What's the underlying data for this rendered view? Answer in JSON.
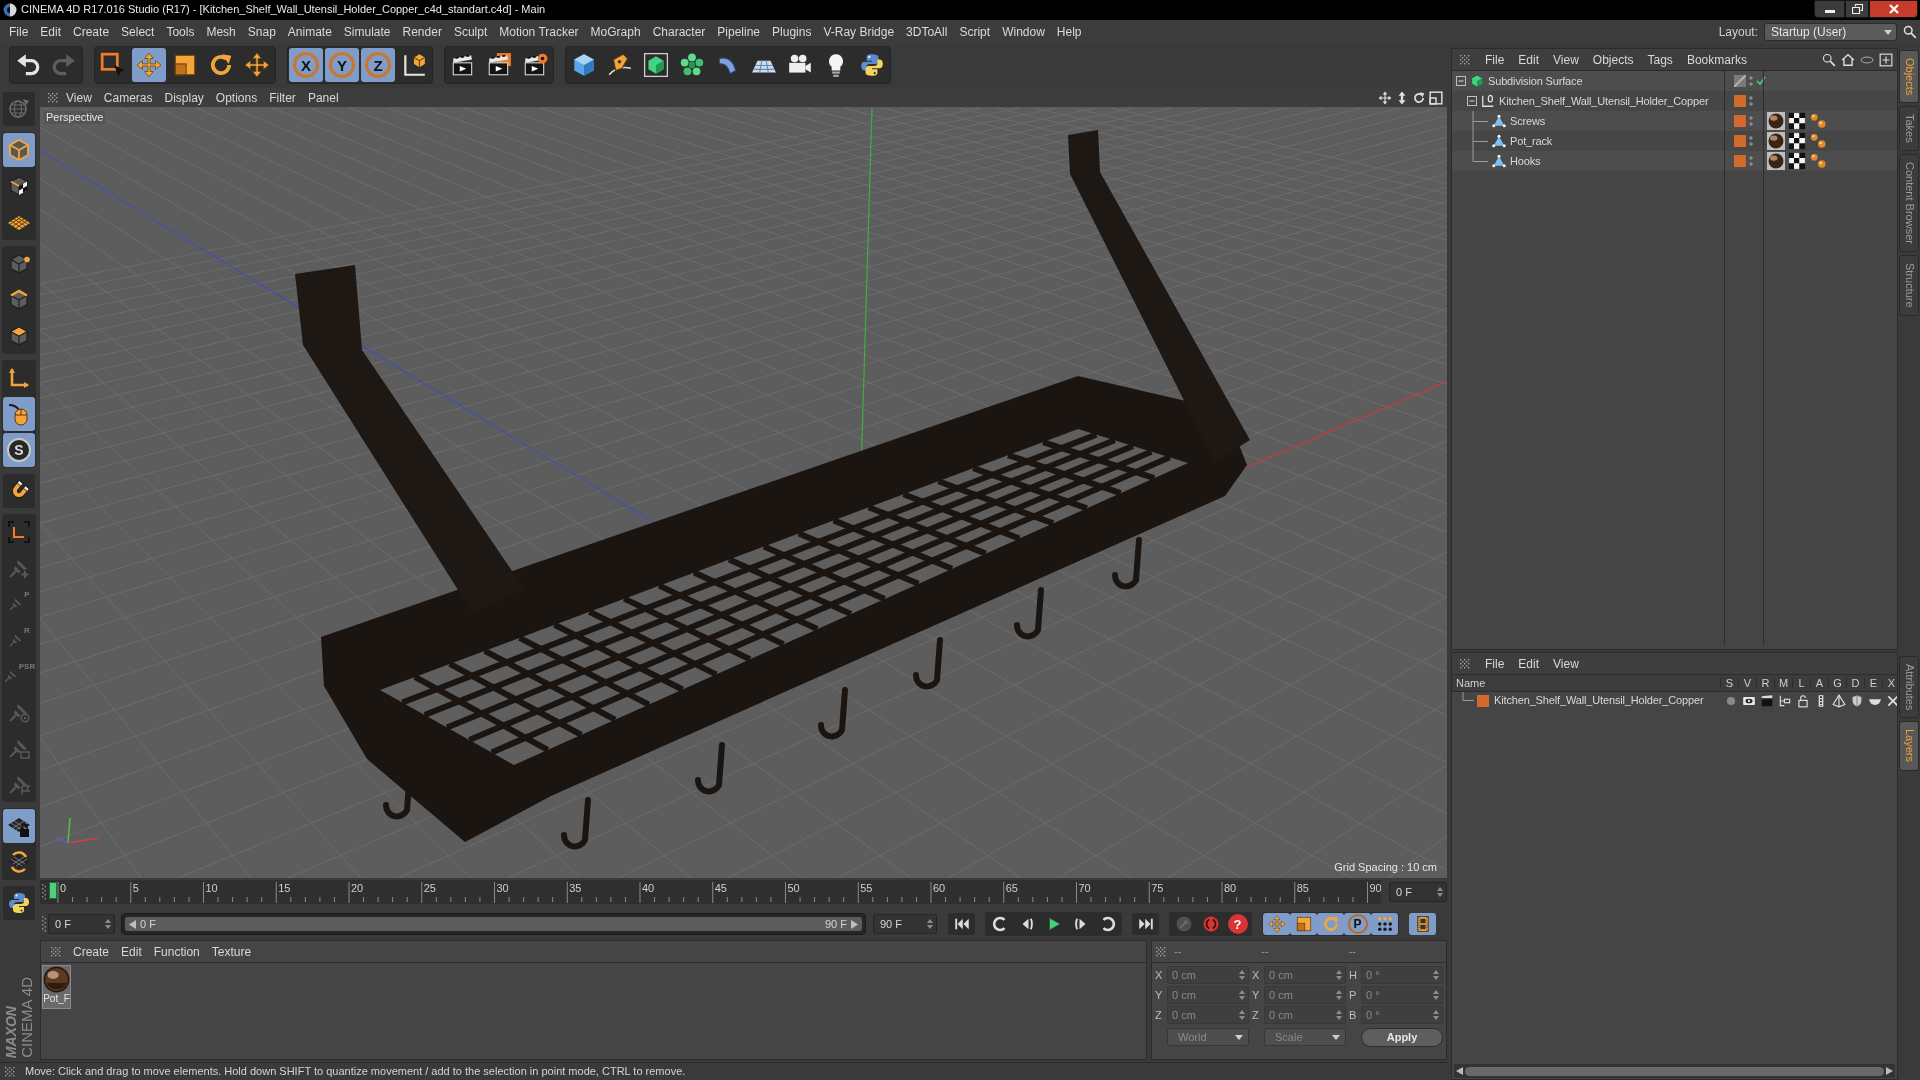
{
  "window": {
    "title": "CINEMA 4D R17.016 Studio (R17) - [Kitchen_Shelf_Wall_Utensil_Holder_Copper_c4d_standart.c4d] - Main"
  },
  "menu_bar": [
    "File",
    "Edit",
    "Create",
    "Select",
    "Tools",
    "Mesh",
    "Snap",
    "Animate",
    "Simulate",
    "Render",
    "Sculpt",
    "Motion Tracker",
    "MoGraph",
    "Character",
    "Pipeline",
    "Plugins",
    "V-Ray Bridge",
    "3DToAll",
    "Script",
    "Window",
    "Help"
  ],
  "layout": {
    "label": "Layout:",
    "value": "Startup (User)"
  },
  "toolbar": [
    [
      {
        "kind": "undo",
        "active": false,
        "disabled": false
      },
      {
        "kind": "redo",
        "active": false,
        "disabled": true
      }
    ],
    [
      {
        "kind": "live_selection",
        "active": false,
        "disabled": false
      },
      {
        "kind": "move",
        "active": true,
        "disabled": false
      },
      {
        "kind": "scale",
        "active": false,
        "disabled": false
      },
      {
        "kind": "rotate",
        "active": false,
        "disabled": false
      },
      {
        "kind": "last_tool",
        "active": false,
        "disabled": false
      }
    ],
    [
      {
        "kind": "x_axis",
        "label": "X",
        "active": true,
        "disabled": false
      },
      {
        "kind": "y_axis",
        "label": "Y",
        "active": true,
        "disabled": false
      },
      {
        "kind": "z_axis",
        "label": "Z",
        "active": true,
        "disabled": false
      },
      {
        "kind": "coordinate_system",
        "active": false,
        "disabled": false
      }
    ],
    [
      {
        "kind": "render_view",
        "active": false,
        "disabled": false
      },
      {
        "kind": "render_picture",
        "active": false,
        "disabled": false
      },
      {
        "kind": "render_settings",
        "active": false,
        "disabled": false
      }
    ],
    [
      {
        "kind": "cube",
        "active": false,
        "disabled": false
      },
      {
        "kind": "pen",
        "active": false,
        "disabled": false
      },
      {
        "kind": "subdivision",
        "active": false,
        "disabled": false
      },
      {
        "kind": "cloner",
        "active": false,
        "disabled": false
      },
      {
        "kind": "deformer",
        "active": false,
        "disabled": false
      },
      {
        "kind": "floor",
        "active": false,
        "disabled": false
      },
      {
        "kind": "camera",
        "active": false,
        "disabled": false
      },
      {
        "kind": "light",
        "active": false,
        "disabled": false
      },
      {
        "kind": "python",
        "active": false,
        "disabled": false
      }
    ]
  ],
  "left_toolbar": [
    [
      {
        "kind": "make_editable",
        "active": false,
        "disabled": true
      }
    ],
    [
      {
        "kind": "model",
        "active": true,
        "disabled": false
      },
      {
        "kind": "texture",
        "active": false,
        "disabled": false
      },
      {
        "kind": "workplane",
        "active": false,
        "disabled": false
      }
    ],
    [
      {
        "kind": "points",
        "active": false,
        "disabled": false
      },
      {
        "kind": "edges",
        "active": false,
        "disabled": false
      },
      {
        "kind": "polygons",
        "active": false,
        "disabled": false
      }
    ],
    [
      {
        "kind": "axis",
        "active": false,
        "disabled": false
      },
      {
        "kind": "tweak",
        "active": true,
        "disabled": false
      },
      {
        "kind": "snap",
        "label": "S",
        "active": true,
        "disabled": false
      }
    ],
    [
      {
        "kind": "magnet",
        "active": false,
        "disabled": false
      }
    ],
    [
      {
        "kind": "workplane_axes",
        "active": false,
        "disabled": false
      },
      {
        "kind": "pin_add",
        "active": false,
        "disabled": true
      },
      {
        "kind": "pin",
        "label": "P",
        "active": false,
        "disabled": true
      },
      {
        "kind": "pin",
        "label": "R",
        "active": false,
        "disabled": true
      },
      {
        "kind": "pin",
        "label": "PSR",
        "active": false,
        "disabled": true
      },
      {
        "kind": "pin_target",
        "active": false,
        "disabled": true
      },
      {
        "kind": "pin_box",
        "active": false,
        "disabled": true
      },
      {
        "kind": "pin_flag",
        "active": false,
        "disabled": true
      }
    ],
    [
      {
        "kind": "grid_lock",
        "active": true,
        "disabled": false
      },
      {
        "kind": "grid_cycle",
        "active": false,
        "disabled": false
      }
    ],
    [
      {
        "kind": "python",
        "active": false,
        "disabled": false
      }
    ]
  ],
  "viewport": {
    "menu": [
      "View",
      "Cameras",
      "Display",
      "Options",
      "Filter",
      "Panel"
    ],
    "camera": "Perspective",
    "grid_spacing": "Grid Spacing : 10 cm"
  },
  "timeline": {
    "ticks": [
      "0",
      "5",
      "10",
      "15",
      "20",
      "25",
      "30",
      "35",
      "40",
      "45",
      "50",
      "55",
      "60",
      "65",
      "70",
      "75",
      "80",
      "85",
      "90"
    ],
    "level": 0,
    "current_frame": "0 F"
  },
  "time_controls": {
    "start": "0 F",
    "range_start": "0 F",
    "range_end": "90 F",
    "level": 1,
    "end": "90 F",
    "buttons": [
      [
        {
          "kind": "go_start",
          "active": false
        }
      ],
      [
        {
          "kind": "prev_key",
          "active": false
        },
        {
          "kind": "prev_frame",
          "active": false
        },
        {
          "kind": "play",
          "active": false
        },
        {
          "kind": "next_frame",
          "active": false
        },
        {
          "kind": "next_key",
          "active": false
        }
      ],
      [
        {
          "kind": "go_end",
          "active": false
        }
      ],
      [
        {
          "kind": "record_keys",
          "active": false,
          "disabled": true
        },
        {
          "kind": "autokey",
          "active": false,
          "disabled": false
        },
        {
          "kind": "help",
          "label": "?",
          "active": false,
          "disabled": false
        }
      ],
      [
        {
          "kind": "key_position",
          "active": true
        },
        {
          "kind": "key_scale",
          "active": true
        },
        {
          "kind": "key_rotation",
          "active": true
        },
        {
          "kind": "key_parameter",
          "label": "P",
          "active": true
        },
        {
          "kind": "key_points",
          "active": true
        }
      ],
      [
        {
          "kind": "timeline",
          "active": true
        }
      ]
    ]
  },
  "materials": {
    "menu": [
      "Create",
      "Edit",
      "Function",
      "Texture"
    ],
    "items": [
      {
        "name": "Pot_F"
      }
    ]
  },
  "coordinates": {
    "headers": [
      "--",
      "--",
      "--"
    ],
    "disabled": true,
    "rows": [
      {
        "position_axis": "X",
        "position": "0 cm",
        "size_axis": "X",
        "size": "0 cm",
        "rotation_axis": "H",
        "rotation": "0 °"
      },
      {
        "position_axis": "Y",
        "position": "0 cm",
        "size_axis": "Y",
        "size": "0 cm",
        "rotation_axis": "P",
        "rotation": "0 °"
      },
      {
        "position_axis": "Z",
        "position": "0 cm",
        "size_axis": "Z",
        "size": "0 cm",
        "rotation_axis": "B",
        "rotation": "0 °"
      }
    ],
    "space": "World",
    "size_mode": "Scale",
    "apply": "Apply"
  },
  "status_bar": {
    "text": "Move: Click and drag to move elements. Hold down SHIFT to quantize movement / add to the selection in point mode, CTRL to remove."
  },
  "logo": {
    "brand": "MAXON",
    "product": "CINEMA 4D"
  },
  "object_manager": {
    "menu": [
      "File",
      "Edit",
      "View",
      "Objects",
      "Tags",
      "Bookmarks"
    ],
    "objects": [
      {
        "name": "Subdivision Surface",
        "kind": "subdivision",
        "expanded": true,
        "enabled": true,
        "children": [
          {
            "name": "Kitchen_Shelf_Wall_Utensil_Holder_Copper",
            "kind": "null",
            "expanded": true,
            "color": "#d4692c",
            "children": [
              {
                "name": "Screws",
                "kind": "polygon",
                "color": "#d4692c",
                "tags": [
                  {
                    "kind": "material"
                  },
                  {
                    "kind": "uvw"
                  },
                  {
                    "kind": "phong"
                  }
                ]
              },
              {
                "name": "Pot_rack",
                "kind": "polygon",
                "color": "#d4692c",
                "tags": [
                  {
                    "kind": "material"
                  },
                  {
                    "kind": "uvw"
                  },
                  {
                    "kind": "phong"
                  }
                ]
              },
              {
                "name": "Hooks",
                "kind": "polygon",
                "color": "#d4692c",
                "tags": [
                  {
                    "kind": "material"
                  },
                  {
                    "kind": "uvw"
                  },
                  {
                    "kind": "phong"
                  }
                ]
              }
            ]
          }
        ]
      }
    ]
  },
  "layer_manager": {
    "menu": [
      "File",
      "Edit",
      "View"
    ],
    "columns": [
      "Name",
      "S",
      "V",
      "R",
      "M",
      "L",
      "A",
      "G",
      "D",
      "E",
      "X"
    ],
    "layers": [
      {
        "name": "Kitchen_Shelf_Wall_Utensil_Holder_Copper",
        "color": "#d4692c"
      }
    ]
  },
  "side_tabs": {
    "upper": [
      {
        "label": "Objects",
        "selected": true
      },
      {
        "label": "Takes",
        "selected": false
      },
      {
        "label": "Content Browser",
        "selected": false
      },
      {
        "label": "Structure",
        "selected": false
      }
    ],
    "lower": [
      {
        "label": "Attributes",
        "selected": false
      },
      {
        "label": "Layers",
        "selected": true
      }
    ]
  }
}
